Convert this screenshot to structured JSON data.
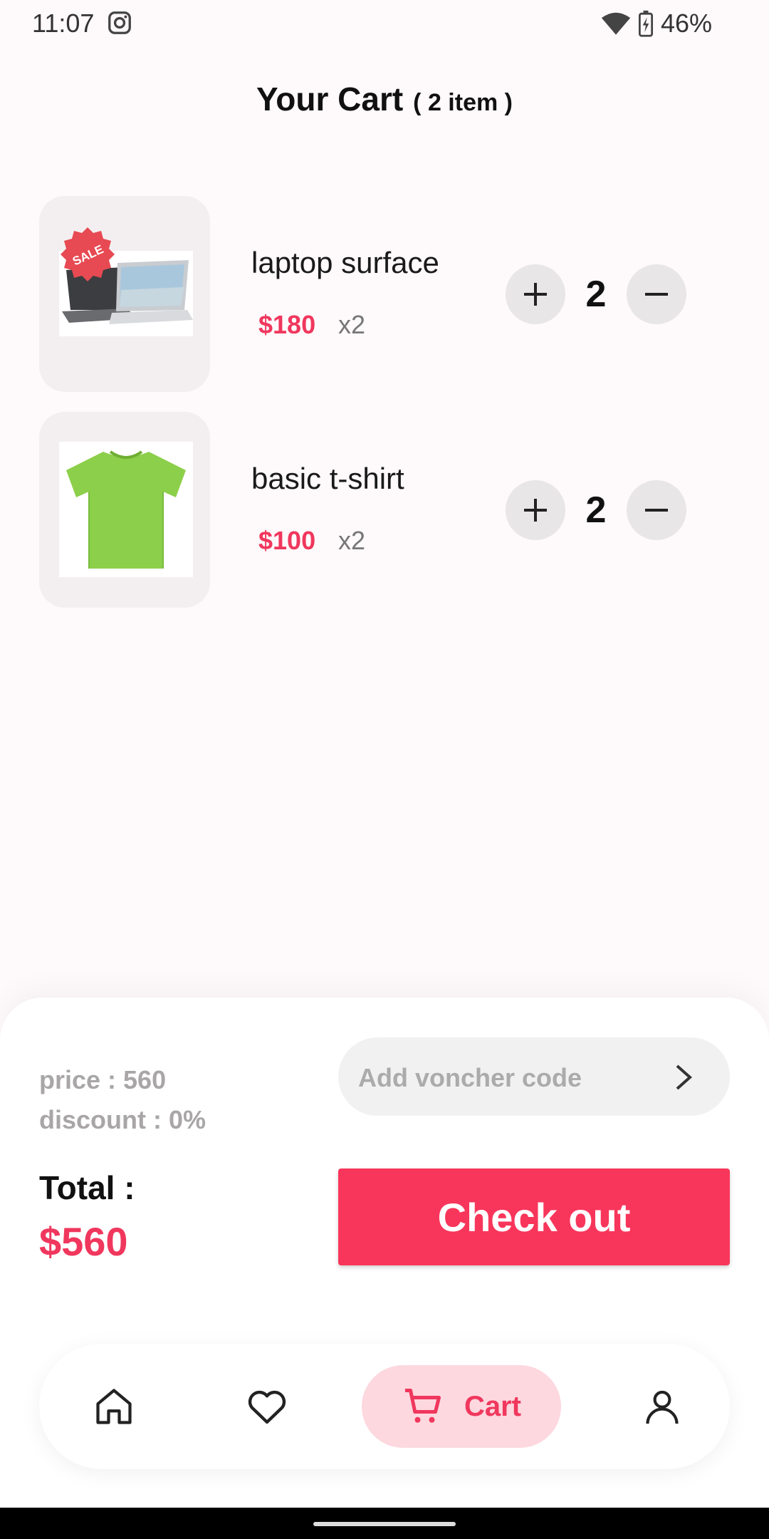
{
  "status_bar": {
    "time": "11:07",
    "battery": "46%"
  },
  "header": {
    "title": "Your Cart",
    "count": "( 2 item )"
  },
  "cart_items": [
    {
      "name": "laptop surface",
      "price": "$180",
      "qty_label": "x2",
      "quantity": "2",
      "sale_badge": "SALE"
    },
    {
      "name": "basic t-shirt",
      "price": "$100",
      "qty_label": "x2",
      "quantity": "2"
    }
  ],
  "summary": {
    "price": "price : 560",
    "discount": "discount : 0%"
  },
  "voucher": {
    "placeholder": "Add voncher code"
  },
  "total": {
    "label": "Total :",
    "value": "$560"
  },
  "checkout": {
    "label": "Check out"
  },
  "nav": {
    "cart_label": "Cart"
  },
  "colors": {
    "accent": "#f8365b",
    "cart_pill": "#fdd8df"
  }
}
